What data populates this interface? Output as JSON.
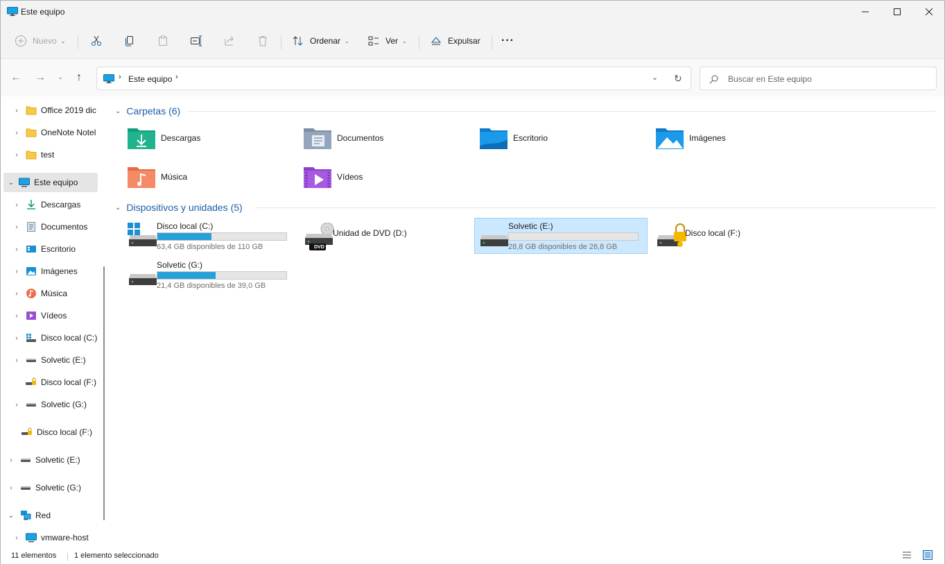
{
  "window": {
    "title": "Este equipo",
    "minimize_icon": "minimize-icon",
    "maximize_icon": "maximize-icon",
    "close_icon": "close-icon"
  },
  "commandbar": {
    "new_label": "Nuevo",
    "sort_label": "Ordenar",
    "view_label": "Ver",
    "eject_label": "Expulsar",
    "more_label": "···"
  },
  "nav": {
    "address_path": "Este equipo",
    "search_placeholder": "Buscar en Este equipo"
  },
  "sidebar": {
    "items": [
      {
        "label": "Office 2019 dic"
      },
      {
        "label": "OneNote Notel"
      },
      {
        "label": "test"
      },
      {
        "label": "Este equipo"
      },
      {
        "label": "Descargas"
      },
      {
        "label": "Documentos"
      },
      {
        "label": "Escritorio"
      },
      {
        "label": "Imágenes"
      },
      {
        "label": "Música"
      },
      {
        "label": "Vídeos"
      },
      {
        "label": "Disco local (C:)"
      },
      {
        "label": "Solvetic (E:)"
      },
      {
        "label": "Disco local (F:)"
      },
      {
        "label": "Solvetic (G:)"
      },
      {
        "label": "Disco local (F:)"
      },
      {
        "label": "Solvetic (E:)"
      },
      {
        "label": "Solvetic (G:)"
      },
      {
        "label": "Red"
      },
      {
        "label": "vmware-host"
      }
    ]
  },
  "main": {
    "folders_header": "Carpetas (6)",
    "folders": [
      {
        "label": "Descargas"
      },
      {
        "label": "Documentos"
      },
      {
        "label": "Escritorio"
      },
      {
        "label": "Imágenes"
      },
      {
        "label": "Música"
      },
      {
        "label": "Vídeos"
      }
    ],
    "devices_header": "Dispositivos y unidades (5)",
    "drives": [
      {
        "label": "Disco local (C:)",
        "space": "63,4 GB disponibles de 110 GB",
        "used_fraction": 0.42
      },
      {
        "label": "Unidad de DVD (D:)",
        "dvd_tag": "DVD"
      },
      {
        "label": "Solvetic (E:)",
        "space": "28,8 GB disponibles de 28,8 GB",
        "used_fraction": 0.0
      },
      {
        "label": "Disco local (F:)"
      },
      {
        "label": "Solvetic (G:)",
        "space": "21,4 GB disponibles de 39,0 GB",
        "used_fraction": 0.45
      }
    ]
  },
  "status": {
    "items": "11 elementos",
    "selected": "1 elemento seleccionado"
  },
  "colors": {
    "accent": "#26a0da",
    "selection": "#cce8ff",
    "group_header": "#1b5fa8"
  }
}
